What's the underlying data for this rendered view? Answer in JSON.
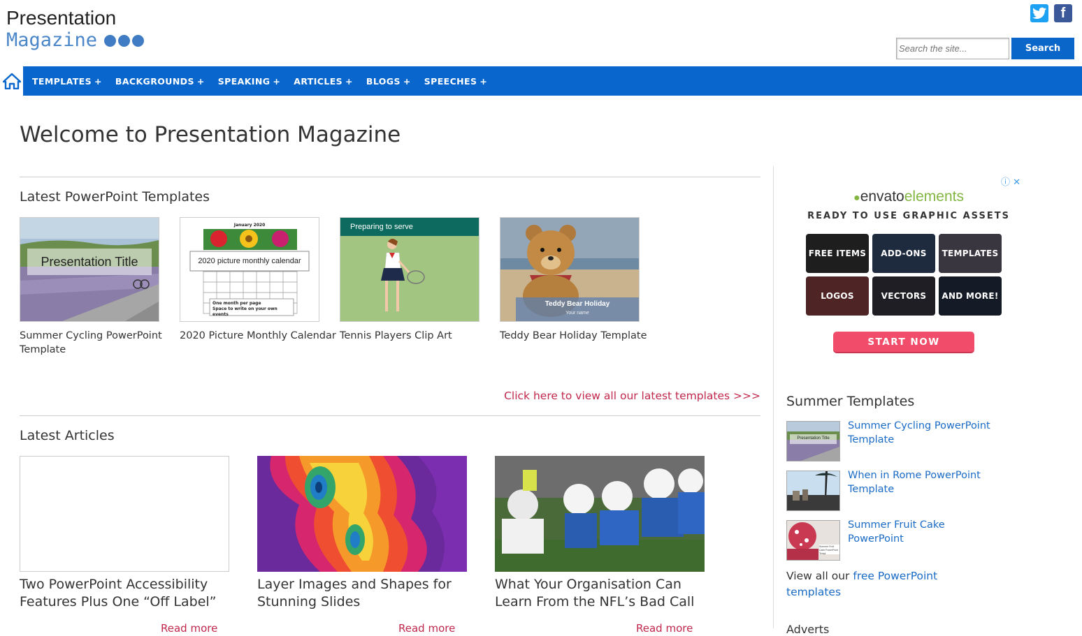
{
  "header": {
    "logo_line1": "Presentation",
    "logo_line2": "Magazine",
    "search_placeholder": "Search the site...",
    "search_button": "Search"
  },
  "nav": {
    "items": [
      "TEMPLATES",
      "BACKGROUNDS",
      "SPEAKING",
      "ARTICLES",
      "BLOGS",
      "SPEECHES"
    ],
    "plus": "+"
  },
  "main": {
    "welcome": "Welcome to Presentation Magazine",
    "latest_templates_title": "Latest PowerPoint Templates",
    "templates": [
      {
        "caption": "Summer Cycling PowerPoint Template",
        "thumb_text": "Presentation Title"
      },
      {
        "caption": "2020 Picture Monthly Calendar",
        "thumb_text": "2020 picture monthly calendar",
        "thumb_header": "January 2020",
        "thumb_footer": "One month per page\nSpace to write on your own events"
      },
      {
        "caption": "Tennis Players Clip Art",
        "thumb_text": "Preparing to serve"
      },
      {
        "caption": "Teddy Bear Holiday Template",
        "thumb_text": "Teddy Bear Holiday",
        "thumb_sub": "Your name"
      }
    ],
    "view_all": "Click here to view all our latest templates >>>",
    "latest_articles_title": "Latest Articles",
    "articles": [
      {
        "title": "Two PowerPoint Accessibility Features Plus One “Off Label”",
        "more": "Read more"
      },
      {
        "title": "Layer Images and Shapes for Stunning Slides",
        "more": "Read more"
      },
      {
        "title": "What Your Organisation Can Learn From the NFL’s Bad Call",
        "more": "Read more"
      }
    ]
  },
  "ad": {
    "brand_a": "envato",
    "brand_b": "elements",
    "tagline": "READY TO USE GRAPHIC ASSETS",
    "tiles": [
      "FREE ITEMS",
      "ADD-ONS",
      "TEMPLATES",
      "LOGOS",
      "VECTORS",
      "AND MORE!"
    ],
    "cta": "START NOW",
    "close": "ⓘ ✕"
  },
  "sidebar": {
    "title": "Summer Templates",
    "items": [
      {
        "label": "Summer Cycling PowerPoint Template",
        "thumb_text": "Presentation Title"
      },
      {
        "label": "When in Rome PowerPoint Template"
      },
      {
        "label": "Summer Fruit Cake PowerPoint",
        "thumb_text": "Summer Fruit Cake PowerPoint Templ"
      }
    ],
    "footer_pre": "View all our ",
    "footer_link": "free PowerPoint templates",
    "cut_heading": "Adverts"
  },
  "colors": {
    "nav_bg": "#0866cc",
    "link": "#1a6bc5",
    "accent_red": "#c0284c",
    "cta": "#f14c6a"
  }
}
